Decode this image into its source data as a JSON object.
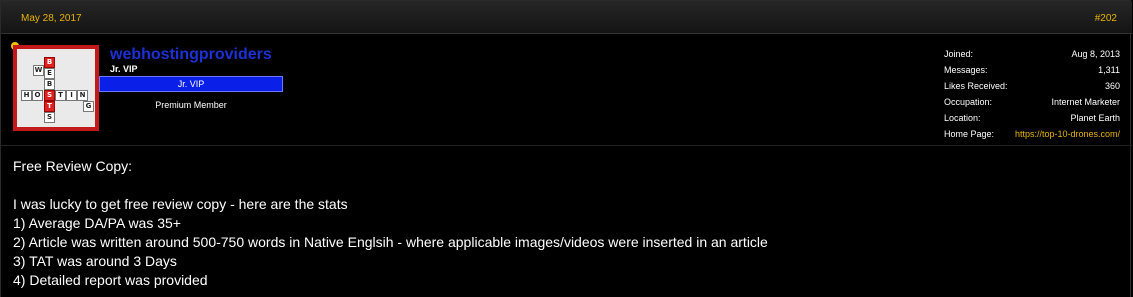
{
  "post": {
    "date": "May 28, 2017",
    "number": "#202"
  },
  "user": {
    "username": "webhostingproviders",
    "title": "Jr. VIP",
    "banner": "Jr. VIP",
    "rank": "Premium Member",
    "online": true,
    "avatar_tiles": [
      "W",
      "E",
      "B",
      "H",
      "O",
      "S",
      "T",
      "I",
      "N",
      "G",
      "B",
      "S",
      "T"
    ],
    "stats": [
      {
        "label": "Joined:",
        "value": "Aug 8, 2013"
      },
      {
        "label": "Messages:",
        "value": "1,311"
      },
      {
        "label": "Likes Received:",
        "value": "360"
      },
      {
        "label": "Occupation:",
        "value": "Internet Marketer"
      },
      {
        "label": "Location:",
        "value": "Planet Earth"
      },
      {
        "label": "Home Page:",
        "value": "https://top-10-drones.com/"
      }
    ]
  },
  "body": {
    "lines": [
      "Free Review Copy:",
      "",
      "I was lucky to get free review copy - here are the stats",
      "1) Average DA/PA was 35+",
      "2) Article was written around 500-750 words in Native Englsih - where applicable images/videos were inserted in an article",
      "3) TAT was around 3 Days",
      "4) Detailed report was provided"
    ]
  },
  "colors": {
    "accent": "#e8b400",
    "username": "#1c30d6",
    "banner": "#0a1fe8",
    "avatar_border": "#c21a1a"
  }
}
